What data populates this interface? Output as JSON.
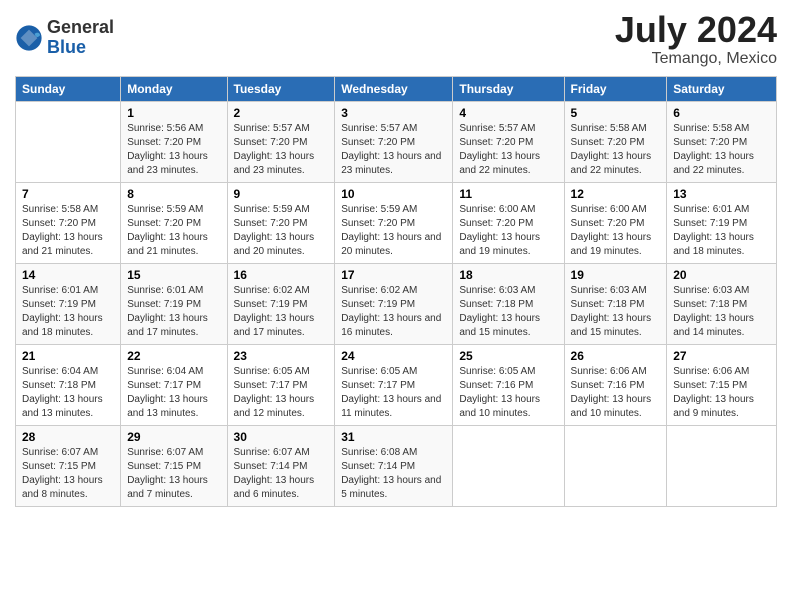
{
  "header": {
    "logo_general": "General",
    "logo_blue": "Blue",
    "month": "July 2024",
    "location": "Temango, Mexico"
  },
  "days_of_week": [
    "Sunday",
    "Monday",
    "Tuesday",
    "Wednesday",
    "Thursday",
    "Friday",
    "Saturday"
  ],
  "weeks": [
    [
      {
        "day": "",
        "info": ""
      },
      {
        "day": "1",
        "info": "Sunrise: 5:56 AM\nSunset: 7:20 PM\nDaylight: 13 hours and 23 minutes."
      },
      {
        "day": "2",
        "info": "Sunrise: 5:57 AM\nSunset: 7:20 PM\nDaylight: 13 hours and 23 minutes."
      },
      {
        "day": "3",
        "info": "Sunrise: 5:57 AM\nSunset: 7:20 PM\nDaylight: 13 hours and 23 minutes."
      },
      {
        "day": "4",
        "info": "Sunrise: 5:57 AM\nSunset: 7:20 PM\nDaylight: 13 hours and 22 minutes."
      },
      {
        "day": "5",
        "info": "Sunrise: 5:58 AM\nSunset: 7:20 PM\nDaylight: 13 hours and 22 minutes."
      },
      {
        "day": "6",
        "info": "Sunrise: 5:58 AM\nSunset: 7:20 PM\nDaylight: 13 hours and 22 minutes."
      }
    ],
    [
      {
        "day": "7",
        "info": "Sunrise: 5:58 AM\nSunset: 7:20 PM\nDaylight: 13 hours and 21 minutes."
      },
      {
        "day": "8",
        "info": "Sunrise: 5:59 AM\nSunset: 7:20 PM\nDaylight: 13 hours and 21 minutes."
      },
      {
        "day": "9",
        "info": "Sunrise: 5:59 AM\nSunset: 7:20 PM\nDaylight: 13 hours and 20 minutes."
      },
      {
        "day": "10",
        "info": "Sunrise: 5:59 AM\nSunset: 7:20 PM\nDaylight: 13 hours and 20 minutes."
      },
      {
        "day": "11",
        "info": "Sunrise: 6:00 AM\nSunset: 7:20 PM\nDaylight: 13 hours and 19 minutes."
      },
      {
        "day": "12",
        "info": "Sunrise: 6:00 AM\nSunset: 7:20 PM\nDaylight: 13 hours and 19 minutes."
      },
      {
        "day": "13",
        "info": "Sunrise: 6:01 AM\nSunset: 7:19 PM\nDaylight: 13 hours and 18 minutes."
      }
    ],
    [
      {
        "day": "14",
        "info": "Sunrise: 6:01 AM\nSunset: 7:19 PM\nDaylight: 13 hours and 18 minutes."
      },
      {
        "day": "15",
        "info": "Sunrise: 6:01 AM\nSunset: 7:19 PM\nDaylight: 13 hours and 17 minutes."
      },
      {
        "day": "16",
        "info": "Sunrise: 6:02 AM\nSunset: 7:19 PM\nDaylight: 13 hours and 17 minutes."
      },
      {
        "day": "17",
        "info": "Sunrise: 6:02 AM\nSunset: 7:19 PM\nDaylight: 13 hours and 16 minutes."
      },
      {
        "day": "18",
        "info": "Sunrise: 6:03 AM\nSunset: 7:18 PM\nDaylight: 13 hours and 15 minutes."
      },
      {
        "day": "19",
        "info": "Sunrise: 6:03 AM\nSunset: 7:18 PM\nDaylight: 13 hours and 15 minutes."
      },
      {
        "day": "20",
        "info": "Sunrise: 6:03 AM\nSunset: 7:18 PM\nDaylight: 13 hours and 14 minutes."
      }
    ],
    [
      {
        "day": "21",
        "info": "Sunrise: 6:04 AM\nSunset: 7:18 PM\nDaylight: 13 hours and 13 minutes."
      },
      {
        "day": "22",
        "info": "Sunrise: 6:04 AM\nSunset: 7:17 PM\nDaylight: 13 hours and 13 minutes."
      },
      {
        "day": "23",
        "info": "Sunrise: 6:05 AM\nSunset: 7:17 PM\nDaylight: 13 hours and 12 minutes."
      },
      {
        "day": "24",
        "info": "Sunrise: 6:05 AM\nSunset: 7:17 PM\nDaylight: 13 hours and 11 minutes."
      },
      {
        "day": "25",
        "info": "Sunrise: 6:05 AM\nSunset: 7:16 PM\nDaylight: 13 hours and 10 minutes."
      },
      {
        "day": "26",
        "info": "Sunrise: 6:06 AM\nSunset: 7:16 PM\nDaylight: 13 hours and 10 minutes."
      },
      {
        "day": "27",
        "info": "Sunrise: 6:06 AM\nSunset: 7:15 PM\nDaylight: 13 hours and 9 minutes."
      }
    ],
    [
      {
        "day": "28",
        "info": "Sunrise: 6:07 AM\nSunset: 7:15 PM\nDaylight: 13 hours and 8 minutes."
      },
      {
        "day": "29",
        "info": "Sunrise: 6:07 AM\nSunset: 7:15 PM\nDaylight: 13 hours and 7 minutes."
      },
      {
        "day": "30",
        "info": "Sunrise: 6:07 AM\nSunset: 7:14 PM\nDaylight: 13 hours and 6 minutes."
      },
      {
        "day": "31",
        "info": "Sunrise: 6:08 AM\nSunset: 7:14 PM\nDaylight: 13 hours and 5 minutes."
      },
      {
        "day": "",
        "info": ""
      },
      {
        "day": "",
        "info": ""
      },
      {
        "day": "",
        "info": ""
      }
    ]
  ]
}
